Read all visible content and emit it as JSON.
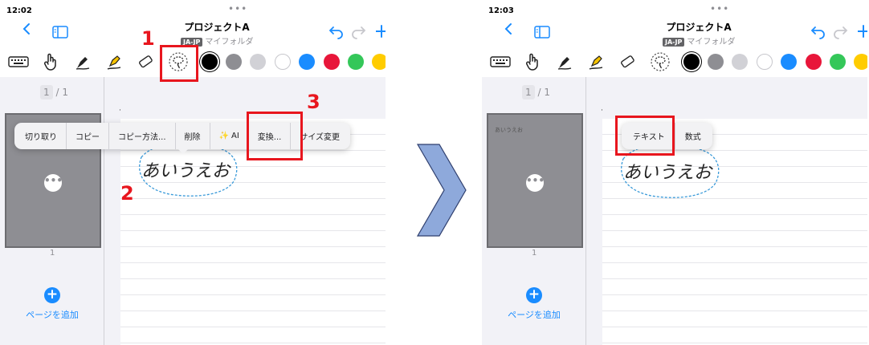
{
  "left_panel": {
    "time": "12:02",
    "title": "プロジェクトA",
    "lang_badge": "JA-JP",
    "folder": "マイフォルダ",
    "page_current": "1",
    "page_total": "/ 1",
    "thumb_number": "1",
    "add_page_label": "ページを追加",
    "context_menu": [
      "切り取り",
      "コピー",
      "コピー方法...",
      "削除",
      "AI",
      "変換...",
      "サイズ変更"
    ],
    "handwriting_text": "あいうえお"
  },
  "right_panel": {
    "time": "12:03",
    "title": "プロジェクトA",
    "lang_badge": "JA-JP",
    "folder": "マイフォルダ",
    "page_current": "1",
    "page_total": "/ 1",
    "thumb_number": "1",
    "thumb_label": "あいうえお",
    "add_page_label": "ページを追加",
    "convert_menu": [
      "テキスト",
      "数式"
    ],
    "handwriting_text": "あいうえお"
  },
  "step_labels": [
    "1",
    "2",
    "3"
  ],
  "icons": {
    "back": "chevron-left-icon",
    "sidebar": "sidebar-icon",
    "undo": "undo-icon",
    "redo": "redo-icon",
    "add": "plus-icon",
    "tools": [
      "keyboard-icon",
      "hand-icon",
      "pen-icon",
      "highlighter-icon",
      "eraser-icon",
      "lasso-icon"
    ]
  },
  "colors": {
    "accent": "#1a8cff",
    "highlight": "#e8161e",
    "arrow": "#8ea9db",
    "swatches": [
      "#000000",
      "#8e8e93",
      "#d1d1d6",
      "#ffffff",
      "#1a8cff",
      "#e8163a",
      "#34c759",
      "#ffcc00"
    ]
  }
}
